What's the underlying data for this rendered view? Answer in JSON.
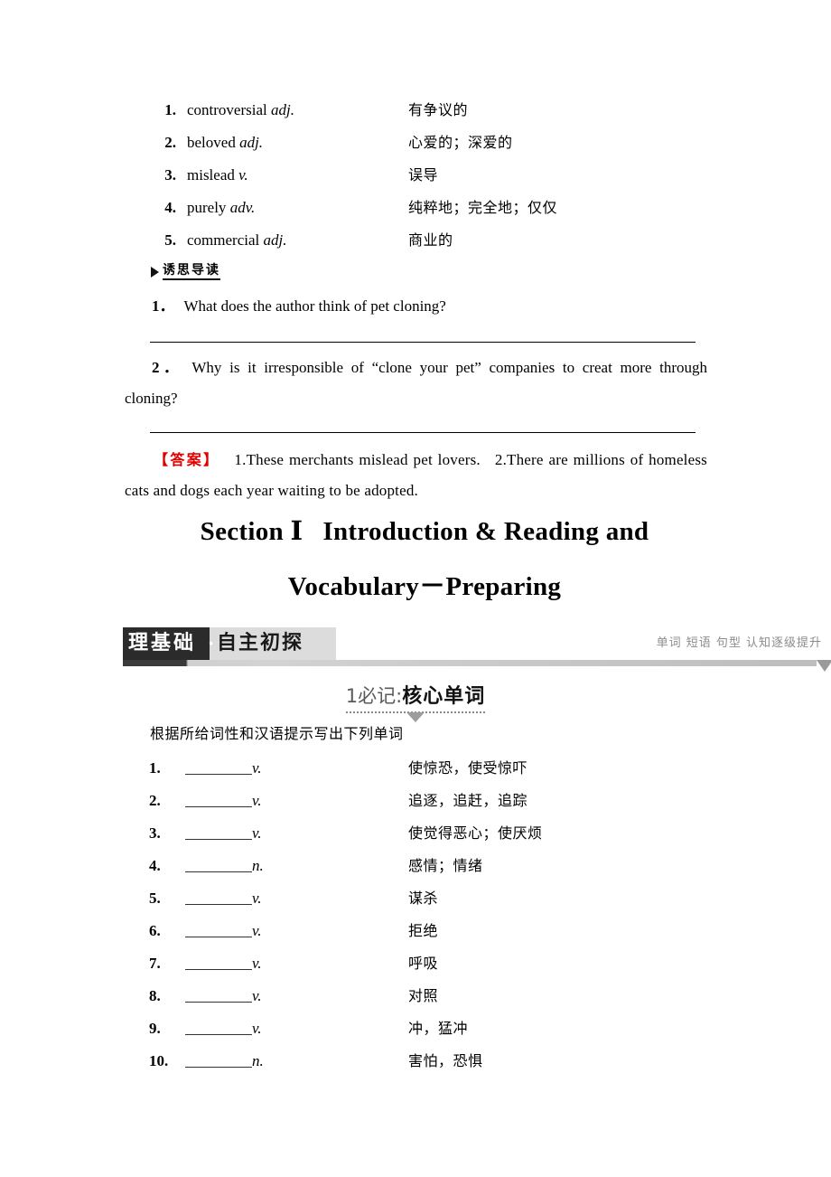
{
  "vocab_preview": {
    "items": [
      {
        "num": "1",
        "word": "controversial",
        "pos": "adj.",
        "cn": "有争议的"
      },
      {
        "num": "2",
        "word": "beloved",
        "pos": "adj.",
        "cn": "心爱的；深爱的"
      },
      {
        "num": "3",
        "word": "mislead",
        "pos": "v.",
        "cn": "误导"
      },
      {
        "num": "4",
        "word": "purely",
        "pos": "adv.",
        "cn": "纯粹地；完全地；仅仅"
      },
      {
        "num": "5",
        "word": "commercial",
        "pos": "adj.",
        "cn": "商业的"
      }
    ]
  },
  "guided_reading": {
    "header_label": "诱思导读",
    "questions": [
      {
        "num": "1．",
        "text": "What does the author think of pet cloning?"
      },
      {
        "num": "2．",
        "text": "Why is it irresponsible of “clone your pet” companies to creat more through cloning?"
      }
    ]
  },
  "answer": {
    "label": "【答案】",
    "part1": "1.These merchants mislead pet lovers.",
    "part2": "2.There are millions of homeless cats and dogs each year waiting to be adopted."
  },
  "section": {
    "line1_a": "Section Ⅰ",
    "line1_b": "Introduction & Reading and",
    "line2": "Vocabulary－Preparing"
  },
  "banner": {
    "text_a": "理基础",
    "dot": "·",
    "text_b": "自主初探",
    "tagline": "单词 短语 句型 认知逐级提升"
  },
  "subsection": {
    "prefix": "1必记:",
    "main": "核心单词"
  },
  "instruction": "根据所给词性和汉语提示写出下列单词",
  "word_exercise": {
    "items": [
      {
        "num": "1",
        "pos": "v.",
        "cn": "使惊恐，使受惊吓"
      },
      {
        "num": "2",
        "pos": "v.",
        "cn": "追逐，追赶，追踪"
      },
      {
        "num": "3",
        "pos": "v.",
        "cn": "使觉得恶心；使厌烦"
      },
      {
        "num": "4",
        "pos": "n.",
        "cn": "感情；情绪"
      },
      {
        "num": "5",
        "pos": "v.",
        "cn": "谋杀"
      },
      {
        "num": "6",
        "pos": "v.",
        "cn": "拒绝"
      },
      {
        "num": "7",
        "pos": "v.",
        "cn": "呼吸"
      },
      {
        "num": "8",
        "pos": "v.",
        "cn": "对照"
      },
      {
        "num": "9",
        "pos": "v.",
        "cn": "冲，猛冲"
      },
      {
        "num": "10",
        "pos": "n.",
        "cn": "害怕，恐惧"
      }
    ]
  },
  "colors": {
    "answer_label": "#e00000",
    "banner_dark": "#2b2b2b",
    "banner_light": "#dcdcdc",
    "tagline_gray": "#8c8c8c"
  }
}
